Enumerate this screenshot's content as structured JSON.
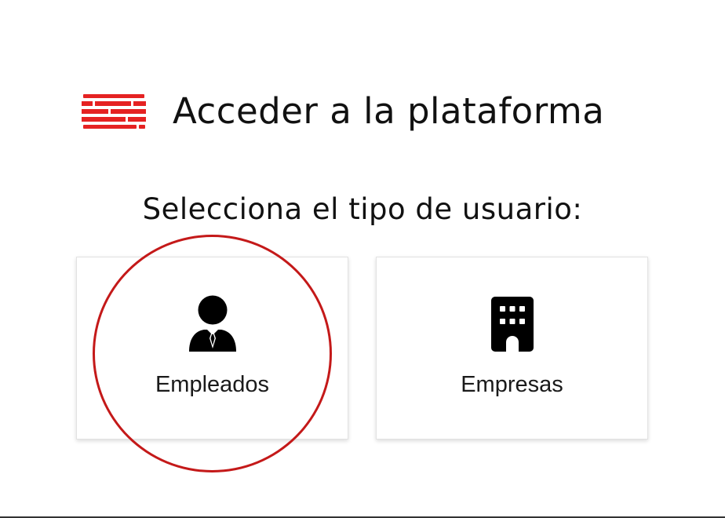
{
  "header": {
    "title": "Acceder a la plataforma",
    "logo_icon": "striped-brand-logo",
    "brand_color": "#e52222"
  },
  "subtitle": "Selecciona el tipo de usuario:",
  "cards": [
    {
      "label": "Empleados",
      "icon": "person-with-tie-icon"
    },
    {
      "label": "Empresas",
      "icon": "building-icon"
    }
  ],
  "annotation": {
    "type": "highlight-circle",
    "target": "Empleados",
    "color": "#c41919"
  }
}
